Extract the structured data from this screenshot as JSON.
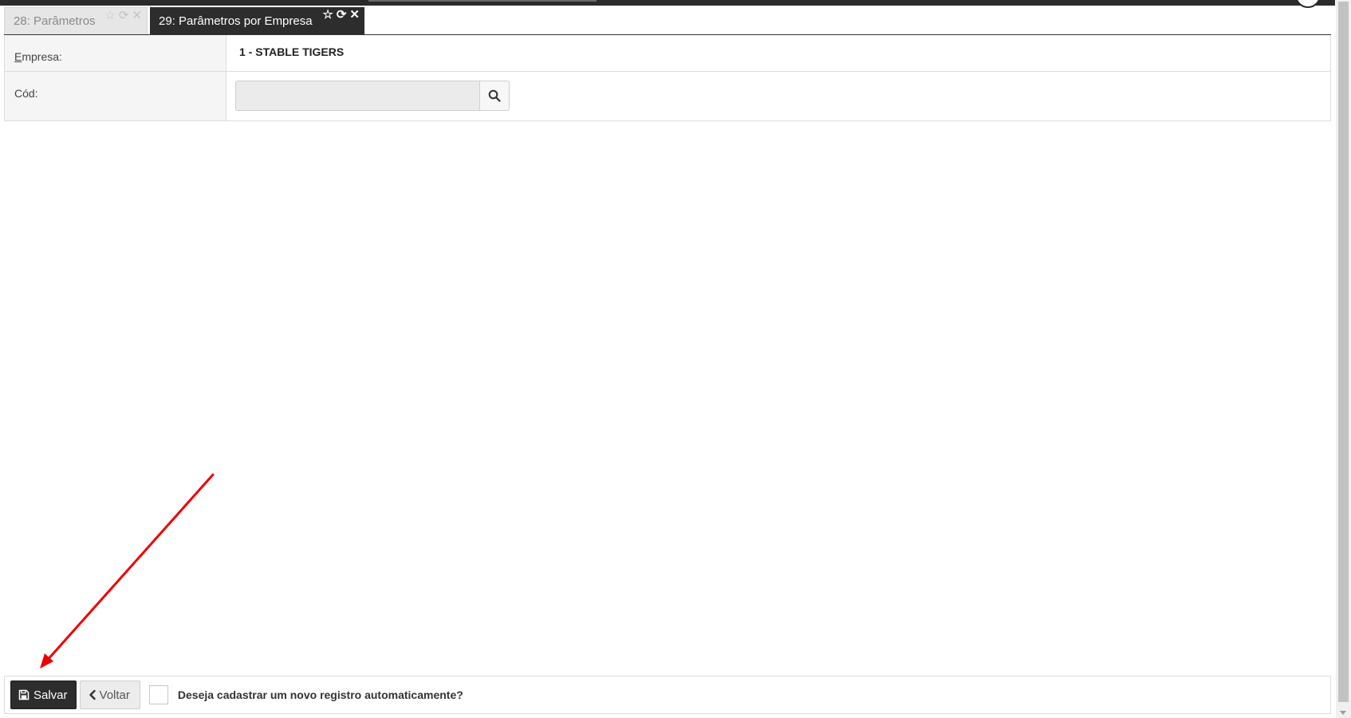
{
  "tabs": [
    {
      "label": "28: Parâmetros",
      "active": false
    },
    {
      "label": "29: Parâmetros por Empresa",
      "active": true
    }
  ],
  "tab_icons": [
    "star-icon",
    "refresh-icon",
    "close-icon"
  ],
  "form": {
    "empresa": {
      "label_underlined": "E",
      "label_rest": "mpresa:",
      "value": "1 - STABLE TIGERS"
    },
    "cod": {
      "label": "Cód:",
      "value": "",
      "placeholder": ""
    }
  },
  "footer": {
    "save_label": "Salvar",
    "back_label": "Voltar",
    "checkbox_label": "Deseja cadastrar um novo registro automaticamente?",
    "checkbox_checked": false
  },
  "colors": {
    "active_tab": "#2d2d2d",
    "annotation_arrow": "#ee0000"
  }
}
